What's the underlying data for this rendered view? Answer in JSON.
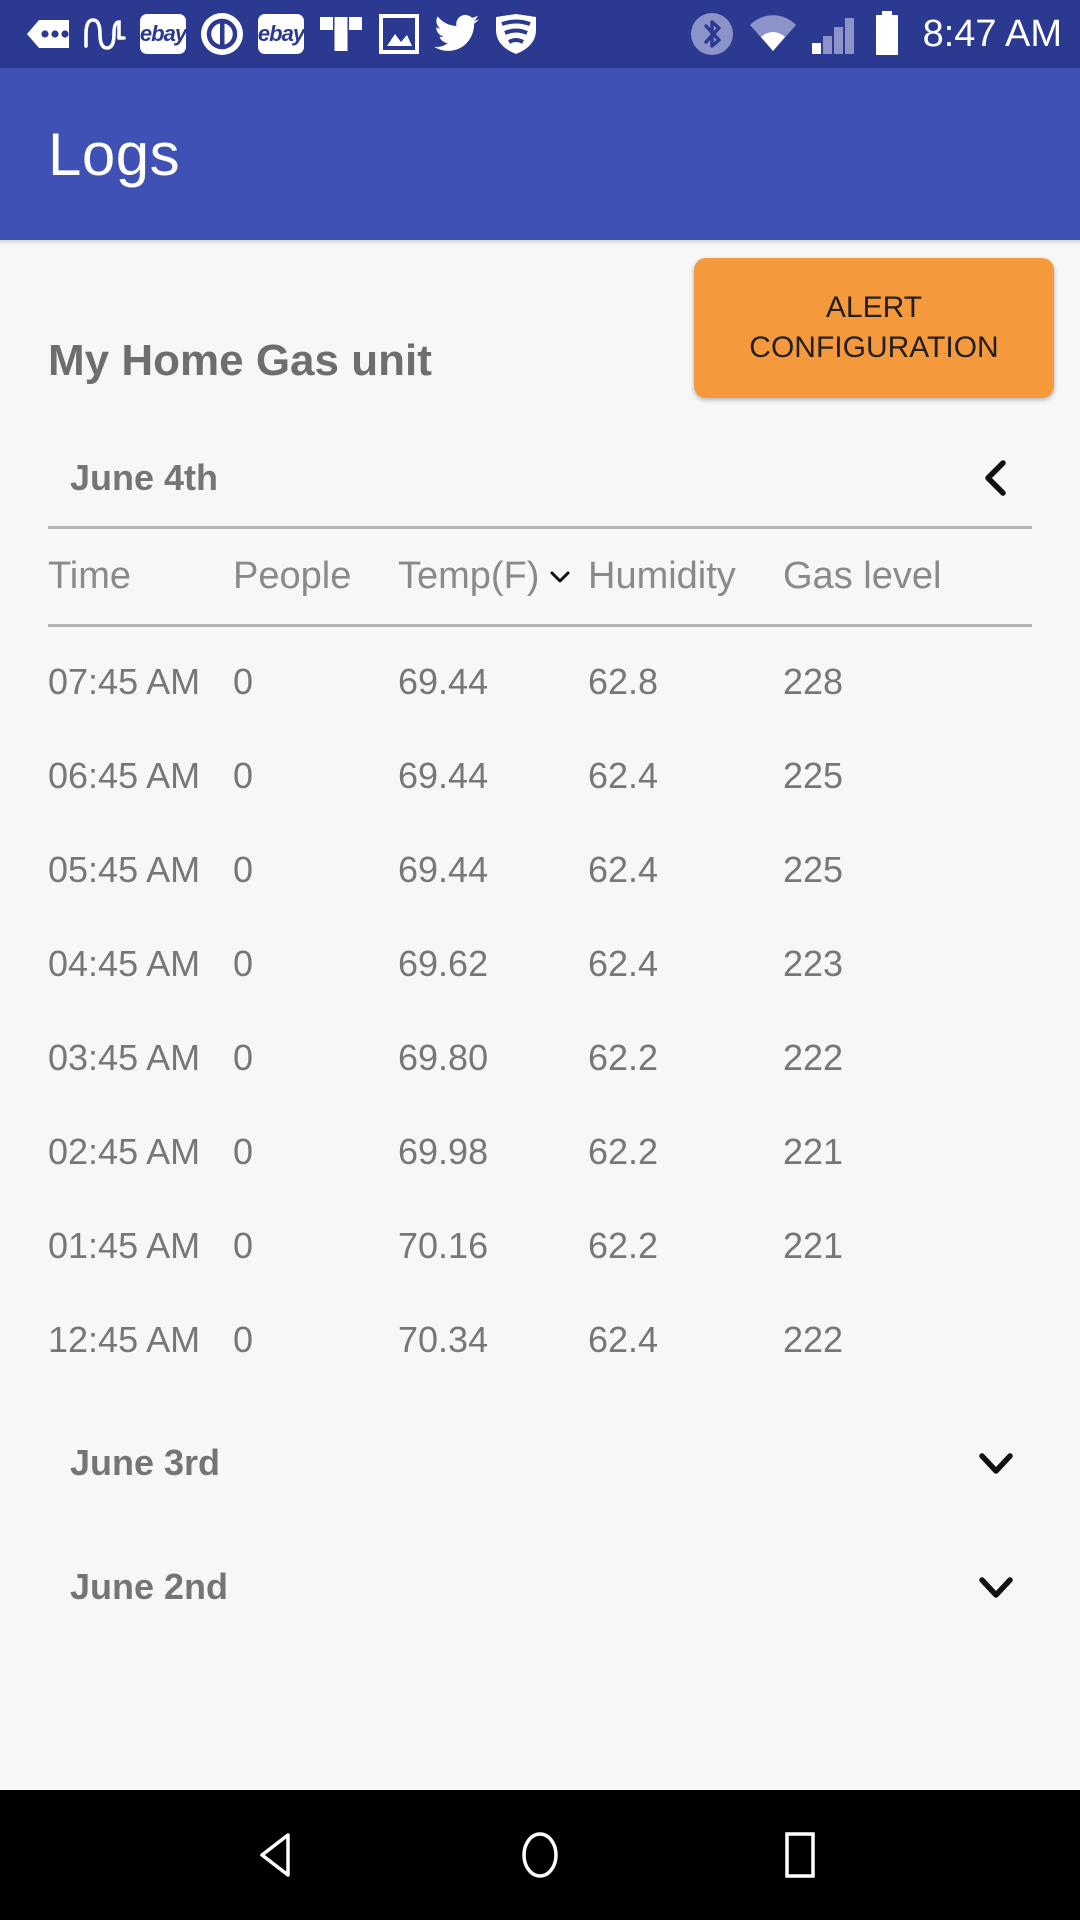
{
  "status_bar": {
    "time": "8:47 AM",
    "left_icons": [
      {
        "name": "messages-tag-icon",
        "label": "..."
      },
      {
        "name": "waveform-icon",
        "label": "musically"
      },
      {
        "name": "ebay-icon",
        "label": "ebay"
      },
      {
        "name": "quickbooks-icon",
        "label": "qb"
      },
      {
        "name": "ebay-icon-2",
        "label": "ebay"
      },
      {
        "name": "tmobile-icon",
        "label": "T"
      },
      {
        "name": "photo-icon",
        "label": "photo"
      },
      {
        "name": "twitter-icon",
        "label": "twitter"
      },
      {
        "name": "shield-wifi-icon",
        "label": "shield"
      }
    ],
    "right_icons": [
      {
        "name": "bluetooth-icon"
      },
      {
        "name": "wifi-icon"
      },
      {
        "name": "cellular-signal-icon"
      },
      {
        "name": "battery-icon"
      }
    ]
  },
  "app_bar": {
    "title": "Logs"
  },
  "device": {
    "name": "My Home Gas unit",
    "alert_button_line1": "ALERT",
    "alert_button_line2": "CONFIGURATION"
  },
  "table": {
    "columns": [
      "Time",
      "People",
      "Temp(F)",
      "Humidity",
      "Gas level"
    ],
    "sort_column": "Temp(F)",
    "sort_icon": "chevron-down-icon"
  },
  "sections": [
    {
      "date": "June 4th",
      "expanded": true,
      "toggle_icon": "chevron-left-icon",
      "rows": [
        {
          "time": "07:45 AM",
          "people": "0",
          "temp": "69.44",
          "humidity": "62.8",
          "gas": "228"
        },
        {
          "time": "06:45 AM",
          "people": "0",
          "temp": "69.44",
          "humidity": "62.4",
          "gas": "225"
        },
        {
          "time": "05:45 AM",
          "people": "0",
          "temp": "69.44",
          "humidity": "62.4",
          "gas": "225"
        },
        {
          "time": "04:45 AM",
          "people": "0",
          "temp": "69.62",
          "humidity": "62.4",
          "gas": "223"
        },
        {
          "time": "03:45 AM",
          "people": "0",
          "temp": "69.80",
          "humidity": "62.2",
          "gas": "222"
        },
        {
          "time": "02:45 AM",
          "people": "0",
          "temp": "69.98",
          "humidity": "62.2",
          "gas": "221"
        },
        {
          "time": "01:45 AM",
          "people": "0",
          "temp": "70.16",
          "humidity": "62.2",
          "gas": "221"
        },
        {
          "time": "12:45 AM",
          "people": "0",
          "temp": "70.34",
          "humidity": "62.4",
          "gas": "222"
        }
      ]
    },
    {
      "date": "June 3rd",
      "expanded": false,
      "toggle_icon": "chevron-down-icon",
      "rows": []
    },
    {
      "date": "June 2nd",
      "expanded": false,
      "toggle_icon": "chevron-down-icon",
      "rows": []
    }
  ],
  "nav_bar": {
    "back": "back-triangle-icon",
    "home": "home-circle-icon",
    "recents": "recents-square-icon"
  },
  "colors": {
    "status_bar": "#2B3990",
    "app_bar": "#3F51B5",
    "accent_orange": "#F5993D",
    "content_bg": "#F7F7F7",
    "text_muted": "#757575",
    "nav_bar": "#000000"
  }
}
